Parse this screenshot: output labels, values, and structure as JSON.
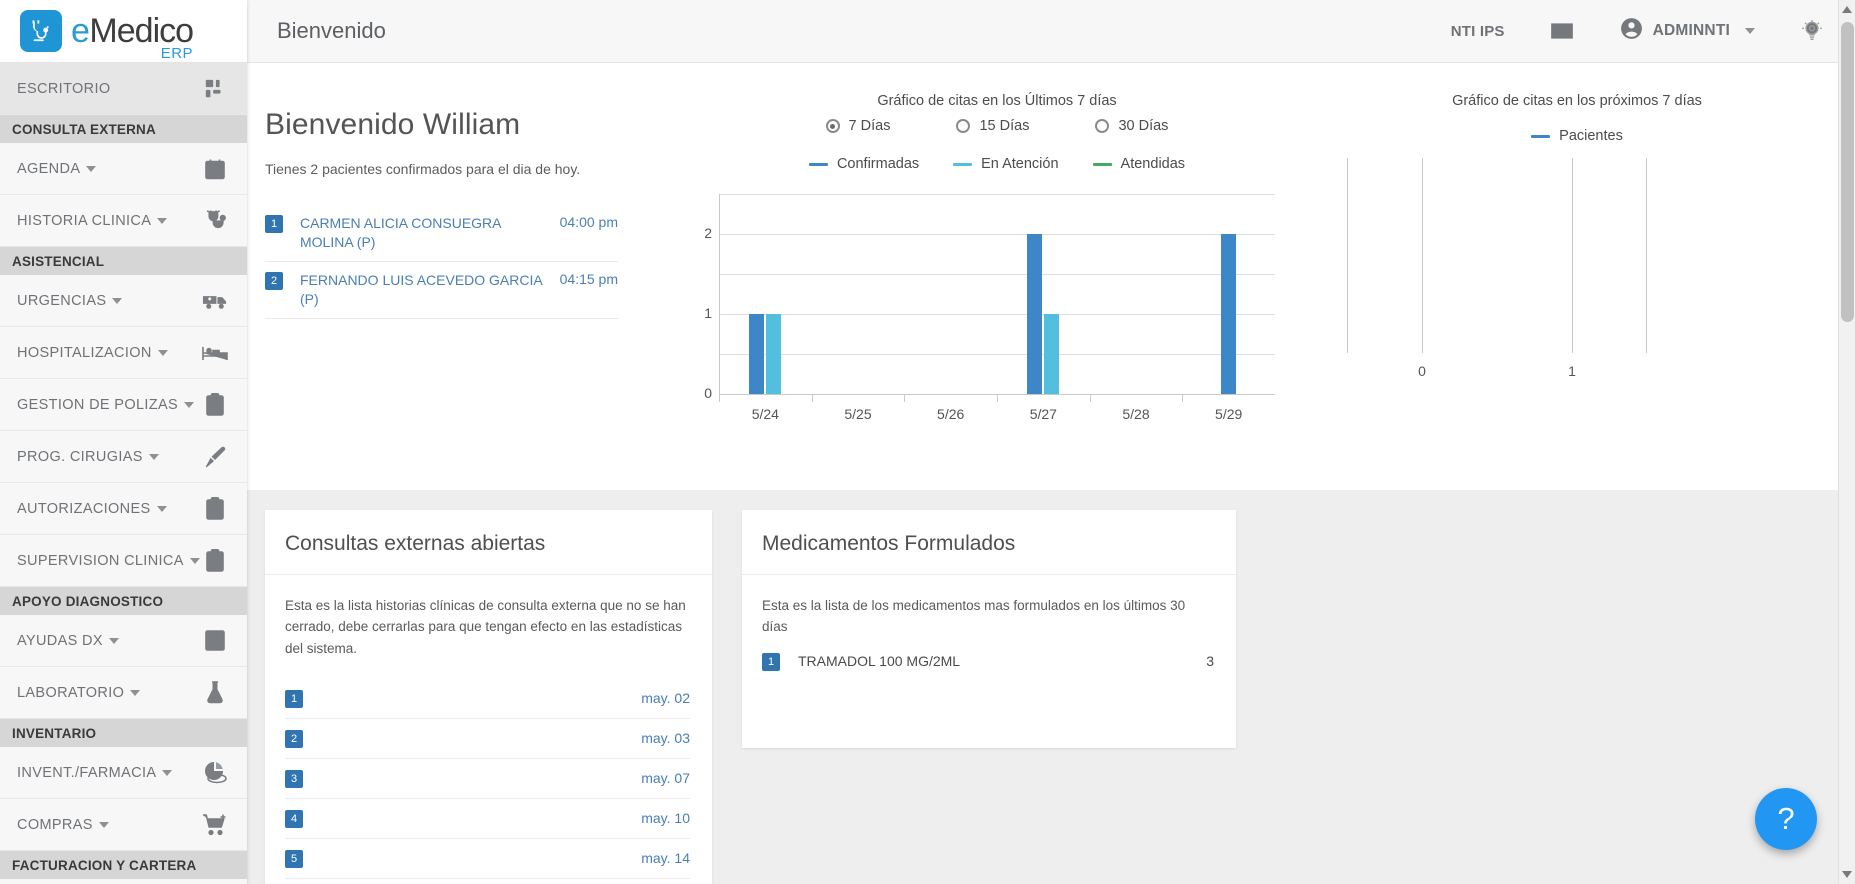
{
  "brand": {
    "logo_e": "e",
    "logo_name": "Medico",
    "logo_suffix": "ERP",
    "logo_icon": "stethoscope-icon",
    "accent": "#2b9ad8"
  },
  "topbar": {
    "title": "Bienvenido",
    "org": "NTI IPS",
    "mail_icon": "mail-icon",
    "user": "ADMINNTI",
    "user_icon": "account-circle-icon",
    "settings_icon": "lightbulb-settings-icon"
  },
  "sidebar": {
    "desktop": {
      "label": "ESCRITORIO",
      "icon": "dashboard-grid-icon"
    },
    "items": [
      {
        "type": "section",
        "label": "CONSULTA EXTERNA"
      },
      {
        "type": "item",
        "label": "AGENDA",
        "icon": "calendar-check-icon",
        "caret": true
      },
      {
        "type": "item",
        "label": "HISTORIA CLINICA",
        "icon": "stethoscope-icon",
        "caret": true
      },
      {
        "type": "section",
        "label": "ASISTENCIAL"
      },
      {
        "type": "item",
        "label": "URGENCIAS",
        "icon": "ambulance-icon",
        "caret": true
      },
      {
        "type": "item",
        "label": "HOSPITALIZACION",
        "icon": "hospital-bed-icon",
        "caret": true
      },
      {
        "type": "item",
        "label": "GESTION DE POLIZAS",
        "icon": "clipboard-check-icon",
        "caret": true
      },
      {
        "type": "item",
        "label": "PROG. CIRUGIAS",
        "icon": "scalpel-icon",
        "caret": true
      },
      {
        "type": "item",
        "label": "AUTORIZACIONES",
        "icon": "clipboard-check-icon",
        "caret": true
      },
      {
        "type": "item",
        "label": "SUPERVISION CLINICA",
        "icon": "clipboard-check-icon",
        "caret": true
      },
      {
        "type": "section",
        "label": "APOYO DIAGNOSTICO"
      },
      {
        "type": "item",
        "label": "AYUDAS DX",
        "icon": "xray-document-icon",
        "caret": true
      },
      {
        "type": "item",
        "label": "LABORATORIO",
        "icon": "flask-icon",
        "caret": true
      },
      {
        "type": "section",
        "label": "INVENTARIO"
      },
      {
        "type": "item",
        "label": "INVENT./FARMACIA",
        "icon": "pie-chart-icon",
        "caret": true
      },
      {
        "type": "item",
        "label": "COMPRAS",
        "icon": "shopping-cart-plus-icon",
        "caret": true
      },
      {
        "type": "section",
        "label": "FACTURACION Y CARTERA"
      }
    ]
  },
  "welcome": {
    "heading": "Bienvenido William",
    "subtitle": "Tienes 2 pacientes confirmados para el dia de hoy.",
    "appointments": [
      {
        "num": "1",
        "name": "CARMEN ALICIA CONSUEGRA MOLINA (P)",
        "time": "04:00 pm"
      },
      {
        "num": "2",
        "name": "FERNANDO LUIS ACEVEDO GARCIA (P)",
        "time": "04:15 pm"
      }
    ]
  },
  "chart_data": [
    {
      "type": "bar",
      "title": "Gráfico de citas en los Últimos 7 días",
      "xlabel": "",
      "ylabel": "",
      "ylim": [
        0,
        2.5
      ],
      "yticks": [
        0,
        1,
        2
      ],
      "grid": true,
      "legend_position": "top",
      "categories": [
        "5/24",
        "5/25",
        "5/26",
        "5/27",
        "5/28",
        "5/29"
      ],
      "series": [
        {
          "name": "Confirmadas",
          "color": "#3d87c8",
          "values": [
            1,
            0,
            0,
            2,
            0,
            2
          ]
        },
        {
          "name": "En Atención",
          "color": "#52bee0",
          "values": [
            1,
            0,
            0,
            1,
            0,
            0
          ]
        },
        {
          "name": "Atendidas",
          "color": "#45a95f",
          "values": [
            0,
            0,
            0,
            0,
            0,
            0
          ]
        }
      ],
      "range_options": [
        {
          "label": "7 Días",
          "selected": true
        },
        {
          "label": "15 Días",
          "selected": false
        },
        {
          "label": "30 Días",
          "selected": false
        }
      ]
    },
    {
      "type": "bar",
      "title": "Gráfico de citas en los próximos 7 días",
      "xlabel": "",
      "ylabel": "",
      "xticks": [
        "0",
        "1"
      ],
      "grid": true,
      "legend_position": "top",
      "categories": [],
      "series": [
        {
          "name": "Pacientes",
          "color": "#3d87c8",
          "values": []
        }
      ]
    }
  ],
  "cards": {
    "consultas": {
      "title": "Consultas externas abiertas",
      "description": "Esta es la lista historias clínicas de consulta externa que no se han cerrado, debe cerrarlas para que tengan efecto en las estadísticas del sistema.",
      "rows": [
        {
          "num": "1",
          "date": "may. 02"
        },
        {
          "num": "2",
          "date": "may. 03"
        },
        {
          "num": "3",
          "date": "may. 07"
        },
        {
          "num": "4",
          "date": "may. 10"
        },
        {
          "num": "5",
          "date": "may. 14"
        }
      ]
    },
    "medicamentos": {
      "title": "Medicamentos Formulados",
      "description": "Esta es la lista de los medicamentos mas formulados en los últimos 30 días",
      "rows": [
        {
          "num": "1",
          "name": "TRAMADOL 100 MG/2ML",
          "count": "3"
        }
      ]
    }
  },
  "help": {
    "label": "?",
    "icon": "help-icon"
  }
}
